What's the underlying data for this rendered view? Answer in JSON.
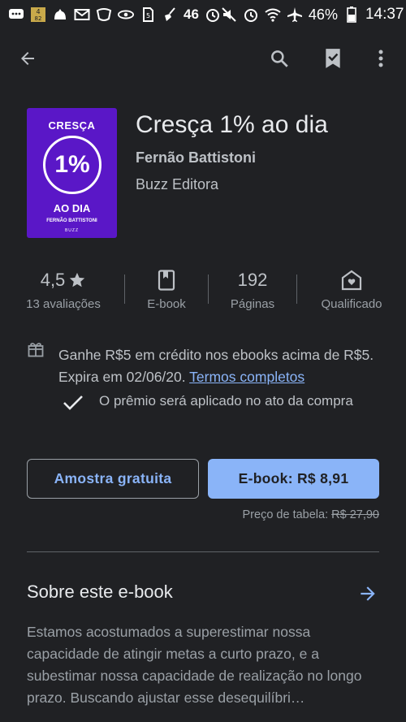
{
  "status_bar": {
    "left_icons": [
      "chat-icon",
      "percent-badge-icon",
      "cat-icon",
      "mail-icon",
      "shield-icon",
      "eye-icon",
      "sim-icon",
      "broom-icon"
    ],
    "badge_text": "4\n82",
    "network": "46",
    "battery_percent": "46%",
    "time": "14:37"
  },
  "app_bar": {
    "icons": [
      "back-arrow-icon",
      "search-icon",
      "bookmark-check-icon",
      "more-vert-icon"
    ]
  },
  "book": {
    "cover": {
      "line1": "CRESÇA",
      "number": "1%",
      "line2": "AO DIA",
      "author": "FERNÃO BATTISTONI",
      "publisher": "BUZZ"
    },
    "title": "Cresça 1% ao dia",
    "author": "Fernão Battistoni",
    "publisher": "Buzz Editora"
  },
  "stats": [
    {
      "value": "4,5",
      "label": "13 avaliações"
    },
    {
      "value": "",
      "label": "E-book"
    },
    {
      "value": "192",
      "label": "Páginas"
    },
    {
      "value": "",
      "label": "Qualificado"
    }
  ],
  "promo": {
    "text": "Ganhe R$5 em crédito nos ebooks acima de R$5. Expira em 02/06/20. ",
    "link": "Termos completos",
    "award": "O prêmio será aplicado no ato da compra"
  },
  "actions": {
    "sample": "Amostra gratuita",
    "buy": "E-book: R$ 8,91"
  },
  "list_price": {
    "label": "Preço de tabela: ",
    "value": "R$ 27,90"
  },
  "about": {
    "title": "Sobre este e-book",
    "text": "Estamos acostumados a superestimar nossa capacidade de atingir metas a curto prazo, e a subestimar nossa capacidade de realização no longo prazo. Buscando ajustar esse desequilíbri…"
  },
  "colors": {
    "background": "#202124",
    "accent": "#8ab4f8",
    "cover": "#5a17c7"
  }
}
